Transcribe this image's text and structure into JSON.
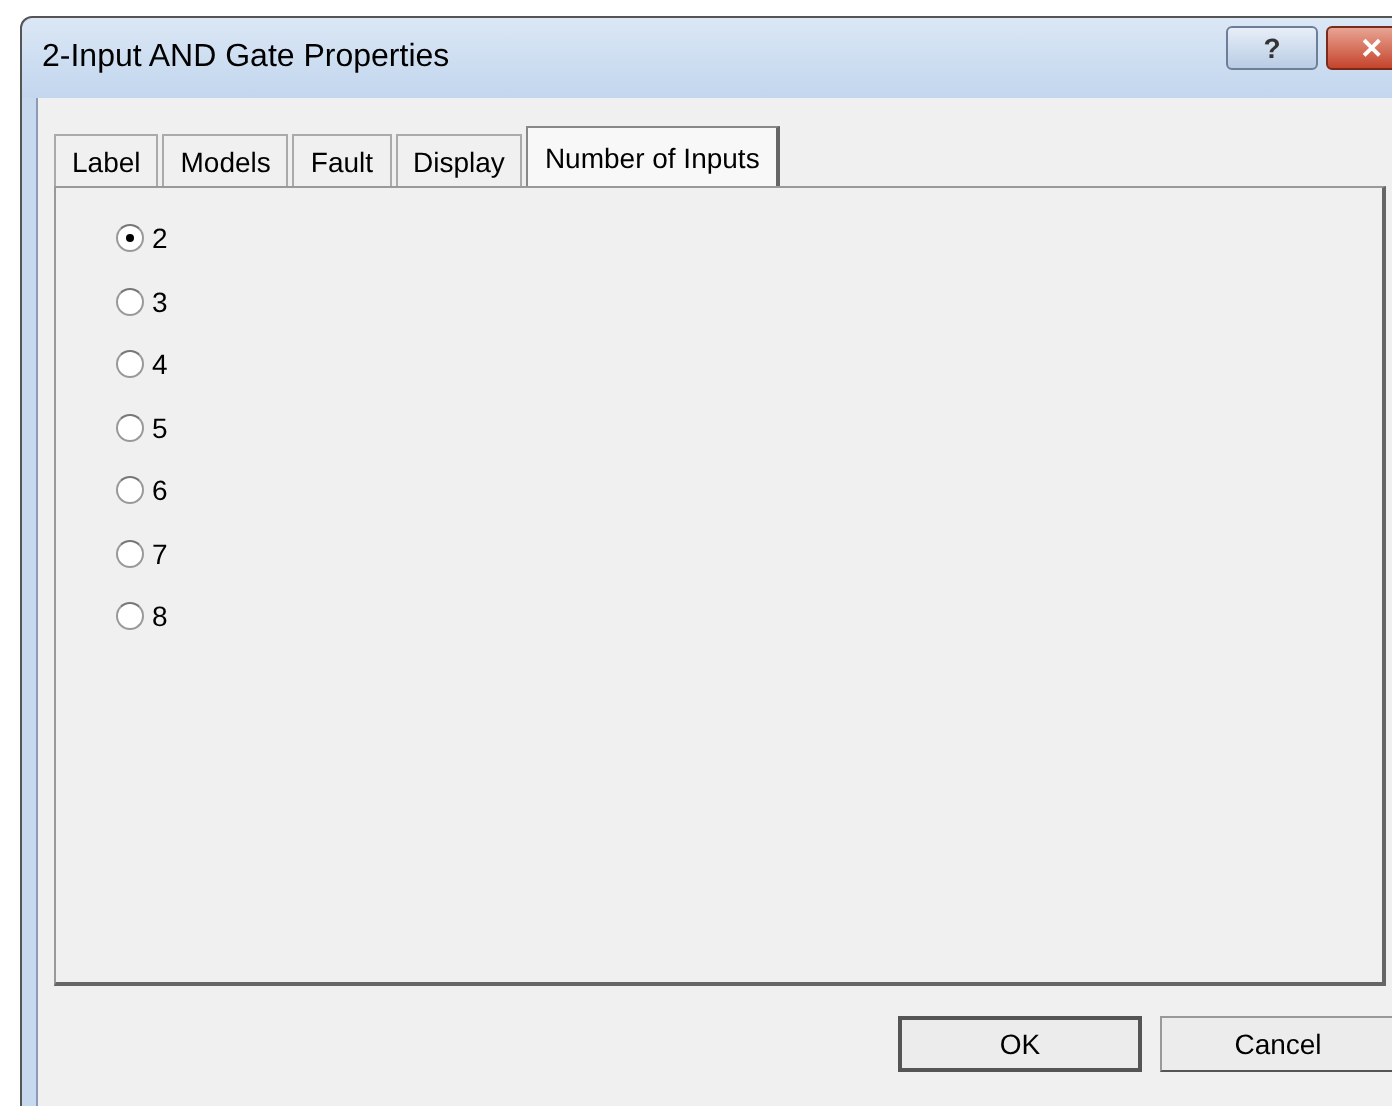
{
  "window": {
    "title": "2-Input AND Gate Properties"
  },
  "title_buttons": [
    {
      "kind": "help",
      "label": "?"
    },
    {
      "kind": "close",
      "label": "✕"
    }
  ],
  "tabs": [
    {
      "label": "Label",
      "selected": false
    },
    {
      "label": "Models",
      "selected": false
    },
    {
      "label": "Fault",
      "selected": false
    },
    {
      "label": "Display",
      "selected": false
    },
    {
      "label": "Number of Inputs",
      "selected": true
    }
  ],
  "options": [
    {
      "label": "2",
      "selected": true
    },
    {
      "label": "3",
      "selected": false
    },
    {
      "label": "4",
      "selected": false
    },
    {
      "label": "5",
      "selected": false
    },
    {
      "label": "6",
      "selected": false
    },
    {
      "label": "7",
      "selected": false
    },
    {
      "label": "8",
      "selected": false
    }
  ],
  "buttons": [
    {
      "label": "OK",
      "default": true
    },
    {
      "label": "Cancel",
      "default": false
    }
  ]
}
